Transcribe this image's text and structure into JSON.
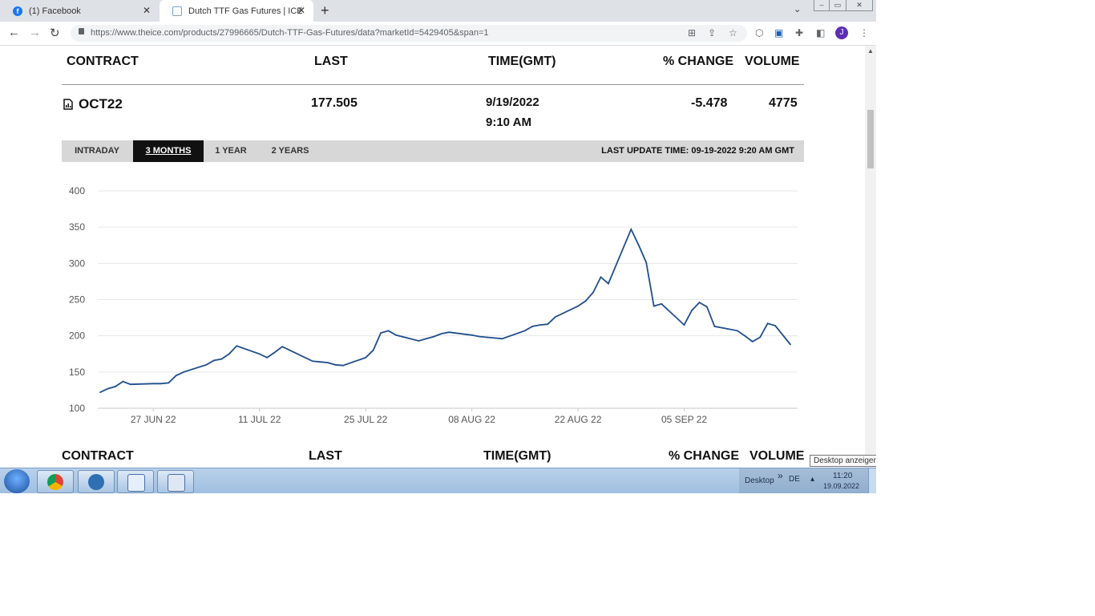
{
  "browser": {
    "tabs": [
      {
        "title": "(1) Facebook"
      },
      {
        "title": "Dutch TTF Gas Futures | ICE"
      }
    ],
    "new_tab_symbol": "+",
    "url": "https://www.theice.com/products/27996665/Dutch-TTF-Gas-Futures/data?marketId=5429405&span=1",
    "profile_initial": "J"
  },
  "table": {
    "headers": {
      "contract": "CONTRACT",
      "last": "LAST",
      "time": "TIME(GMT)",
      "change": "% CHANGE",
      "volume": "VOLUME"
    },
    "row": {
      "contract": "OCT22",
      "last": "177.505",
      "date": "9/19/2022",
      "time": "9:10 AM",
      "change": "-5.478",
      "volume": "4775"
    }
  },
  "range_tabs": [
    {
      "label": "INTRADAY"
    },
    {
      "label": "3 MONTHS"
    },
    {
      "label": "1 YEAR"
    },
    {
      "label": "2 YEARS"
    }
  ],
  "active_range": "3 MONTHS",
  "last_update": "LAST UPDATE TIME: 09-19-2022 9:20 AM GMT",
  "chart_data": {
    "type": "line",
    "ylim": [
      100,
      400
    ],
    "y_ticks": [
      400,
      350,
      300,
      250,
      200,
      150,
      100
    ],
    "x_tick_labels": [
      "27 JUN 22",
      "11 JUL 22",
      "25 JUL 22",
      "08 AUG 22",
      "22 AUG 22",
      "05 SEP 22"
    ],
    "x_tick_dates": [
      "2022-06-27",
      "2022-07-11",
      "2022-07-25",
      "2022-08-08",
      "2022-08-22",
      "2022-09-05"
    ],
    "x_start": "2022-06-20",
    "x_end": "2022-09-19",
    "series_color": "#1f4e8c",
    "series": [
      {
        "points": [
          [
            "2022-06-20",
            122
          ],
          [
            "2022-06-21",
            127
          ],
          [
            "2022-06-22",
            130
          ],
          [
            "2022-06-23",
            137
          ],
          [
            "2022-06-24",
            133
          ],
          [
            "2022-06-27",
            134
          ],
          [
            "2022-06-28",
            134
          ],
          [
            "2022-06-29",
            135
          ],
          [
            "2022-06-30",
            145
          ],
          [
            "2022-07-01",
            150
          ],
          [
            "2022-07-04",
            160
          ],
          [
            "2022-07-05",
            166
          ],
          [
            "2022-07-06",
            168
          ],
          [
            "2022-07-07",
            175
          ],
          [
            "2022-07-08",
            186
          ],
          [
            "2022-07-11",
            175
          ],
          [
            "2022-07-12",
            170
          ],
          [
            "2022-07-13",
            177
          ],
          [
            "2022-07-14",
            185
          ],
          [
            "2022-07-15",
            180
          ],
          [
            "2022-07-18",
            165
          ],
          [
            "2022-07-19",
            164
          ],
          [
            "2022-07-20",
            163
          ],
          [
            "2022-07-21",
            160
          ],
          [
            "2022-07-22",
            159
          ],
          [
            "2022-07-25",
            170
          ],
          [
            "2022-07-26",
            180
          ],
          [
            "2022-07-27",
            204
          ],
          [
            "2022-07-28",
            207
          ],
          [
            "2022-07-29",
            201
          ],
          [
            "2022-08-01",
            193
          ],
          [
            "2022-08-02",
            196
          ],
          [
            "2022-08-03",
            199
          ],
          [
            "2022-08-04",
            203
          ],
          [
            "2022-08-05",
            205
          ],
          [
            "2022-08-08",
            201
          ],
          [
            "2022-08-09",
            199
          ],
          [
            "2022-08-10",
            198
          ],
          [
            "2022-08-11",
            197
          ],
          [
            "2022-08-12",
            196
          ],
          [
            "2022-08-15",
            207
          ],
          [
            "2022-08-16",
            213
          ],
          [
            "2022-08-17",
            215
          ],
          [
            "2022-08-18",
            216
          ],
          [
            "2022-08-19",
            226
          ],
          [
            "2022-08-22",
            241
          ],
          [
            "2022-08-23",
            248
          ],
          [
            "2022-08-24",
            260
          ],
          [
            "2022-08-25",
            281
          ],
          [
            "2022-08-26",
            272
          ],
          [
            "2022-08-29",
            347
          ],
          [
            "2022-08-30",
            325
          ],
          [
            "2022-08-31",
            301
          ],
          [
            "2022-09-01",
            241
          ],
          [
            "2022-09-02",
            244
          ],
          [
            "2022-09-05",
            215
          ],
          [
            "2022-09-06",
            235
          ],
          [
            "2022-09-07",
            246
          ],
          [
            "2022-09-08",
            240
          ],
          [
            "2022-09-09",
            213
          ],
          [
            "2022-09-12",
            207
          ],
          [
            "2022-09-13",
            200
          ],
          [
            "2022-09-14",
            192
          ],
          [
            "2022-09-15",
            198
          ],
          [
            "2022-09-16",
            217
          ],
          [
            "2022-09-17",
            214
          ],
          [
            "2022-09-19",
            188
          ]
        ]
      }
    ]
  },
  "taskbar": {
    "desktop_label": "Desktop",
    "chevrons": "»",
    "language": "DE",
    "clock_time": "11:20",
    "clock_date": "19.09.2022",
    "tooltip": "Desktop anzeigen"
  }
}
